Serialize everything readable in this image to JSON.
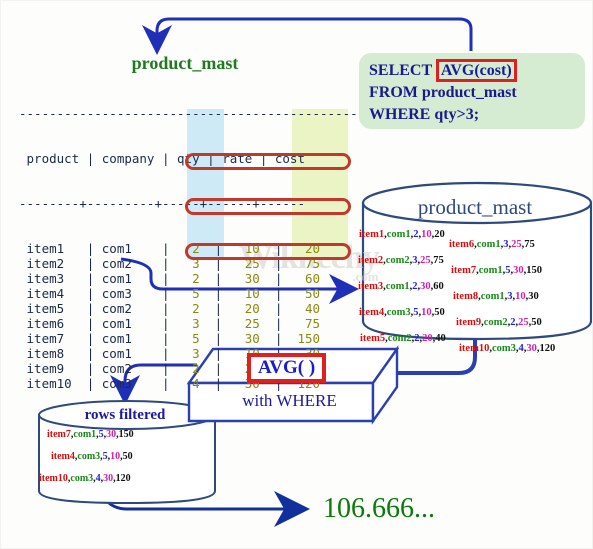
{
  "watermark": {
    "text": "Wikitechy",
    "suffix": ".com"
  },
  "table": {
    "title": "product_mast",
    "top_rule": "---------------------------------------------",
    "header": "product | company | qty | rate | cost",
    "sep_rule": "--------+---------+-----+------+------",
    "columns": [
      "product",
      "company",
      "qty",
      "rate",
      "cost"
    ],
    "rows": [
      {
        "product": "item1",
        "company": "com1",
        "qty": "2",
        "rate": "10",
        "cost": "20",
        "circled": false
      },
      {
        "product": "item2",
        "company": "com2",
        "qty": "3",
        "rate": "25",
        "cost": "75",
        "circled": false
      },
      {
        "product": "item3",
        "company": "com1",
        "qty": "2",
        "rate": "30",
        "cost": "60",
        "circled": false
      },
      {
        "product": "item4",
        "company": "com3",
        "qty": "5",
        "rate": "10",
        "cost": "50",
        "circled": true
      },
      {
        "product": "item5",
        "company": "com2",
        "qty": "2",
        "rate": "20",
        "cost": "40",
        "circled": false
      },
      {
        "product": "item6",
        "company": "com1",
        "qty": "3",
        "rate": "25",
        "cost": "75",
        "circled": false
      },
      {
        "product": "item7",
        "company": "com1",
        "qty": "5",
        "rate": "30",
        "cost": "150",
        "circled": true
      },
      {
        "product": "item8",
        "company": "com1",
        "qty": "3",
        "rate": "10",
        "cost": "30",
        "circled": false
      },
      {
        "product": "item9",
        "company": "com2",
        "qty": "2",
        "rate": "25",
        "cost": "50",
        "circled": false
      },
      {
        "product": "item10",
        "company": "com3",
        "qty": "4",
        "rate": "30",
        "cost": "120",
        "circled": true
      }
    ],
    "highlight_qty_color": "#cfeaf7",
    "highlight_cost_color": "#eaf4c4",
    "circle_color": "#c0392b"
  },
  "sql": {
    "line1_prefix": "SELECT ",
    "line1_highlight": "AVG(cost)",
    "line2": "FROM product_mast",
    "line3": "WHERE qty>3;",
    "box_color": "#d6ecd2",
    "text_color": "#1a1a8c",
    "highlight_border": "#e02020"
  },
  "cylinder_main": {
    "title": "product_mast",
    "rows": [
      {
        "item": "item1",
        "com": "com1",
        "qty": "2",
        "rate": "10",
        "cost": "20"
      },
      {
        "item": "item2",
        "com": "com2",
        "qty": "3",
        "rate": "25",
        "cost": "75"
      },
      {
        "item": "item3",
        "com": "com1",
        "qty": "2",
        "rate": "30",
        "cost": "60"
      },
      {
        "item": "item4",
        "com": "com3",
        "qty": "5",
        "rate": "10",
        "cost": "50"
      },
      {
        "item": "item5",
        "com": "com2",
        "qty": "2",
        "rate": "20",
        "cost": "40"
      },
      {
        "item": "item6",
        "com": "com1",
        "qty": "3",
        "rate": "25",
        "cost": "75"
      },
      {
        "item": "item7",
        "com": "com1",
        "qty": "5",
        "rate": "30",
        "cost": "150"
      },
      {
        "item": "item8",
        "com": "com1",
        "qty": "3",
        "rate": "10",
        "cost": "30"
      },
      {
        "item": "item9",
        "com": "com2",
        "qty": "2",
        "rate": "25",
        "cost": "50"
      },
      {
        "item": "item10",
        "com": "com3",
        "qty": "4",
        "rate": "30",
        "cost": "120"
      }
    ]
  },
  "avg_operator": {
    "label": "AVG( )",
    "sublabel": "with WHERE",
    "highlight_border": "#e02020"
  },
  "cylinder_filtered": {
    "title": "rows filtered",
    "rows": [
      {
        "item": "item7",
        "com": "com1",
        "qty": "5",
        "rate": "30",
        "cost": "150"
      },
      {
        "item": "item4",
        "com": "com3",
        "qty": "5",
        "rate": "10",
        "cost": "50"
      },
      {
        "item": "item10",
        "com": "com3",
        "qty": "4",
        "rate": "30",
        "cost": "120"
      }
    ]
  },
  "result": {
    "value": "106.666..."
  },
  "colors": {
    "arrow": "#1f2fb8",
    "cylinder_stroke": "#2e4a7d",
    "table_title": "#1f7a1f",
    "result": "#0a7a0a"
  }
}
